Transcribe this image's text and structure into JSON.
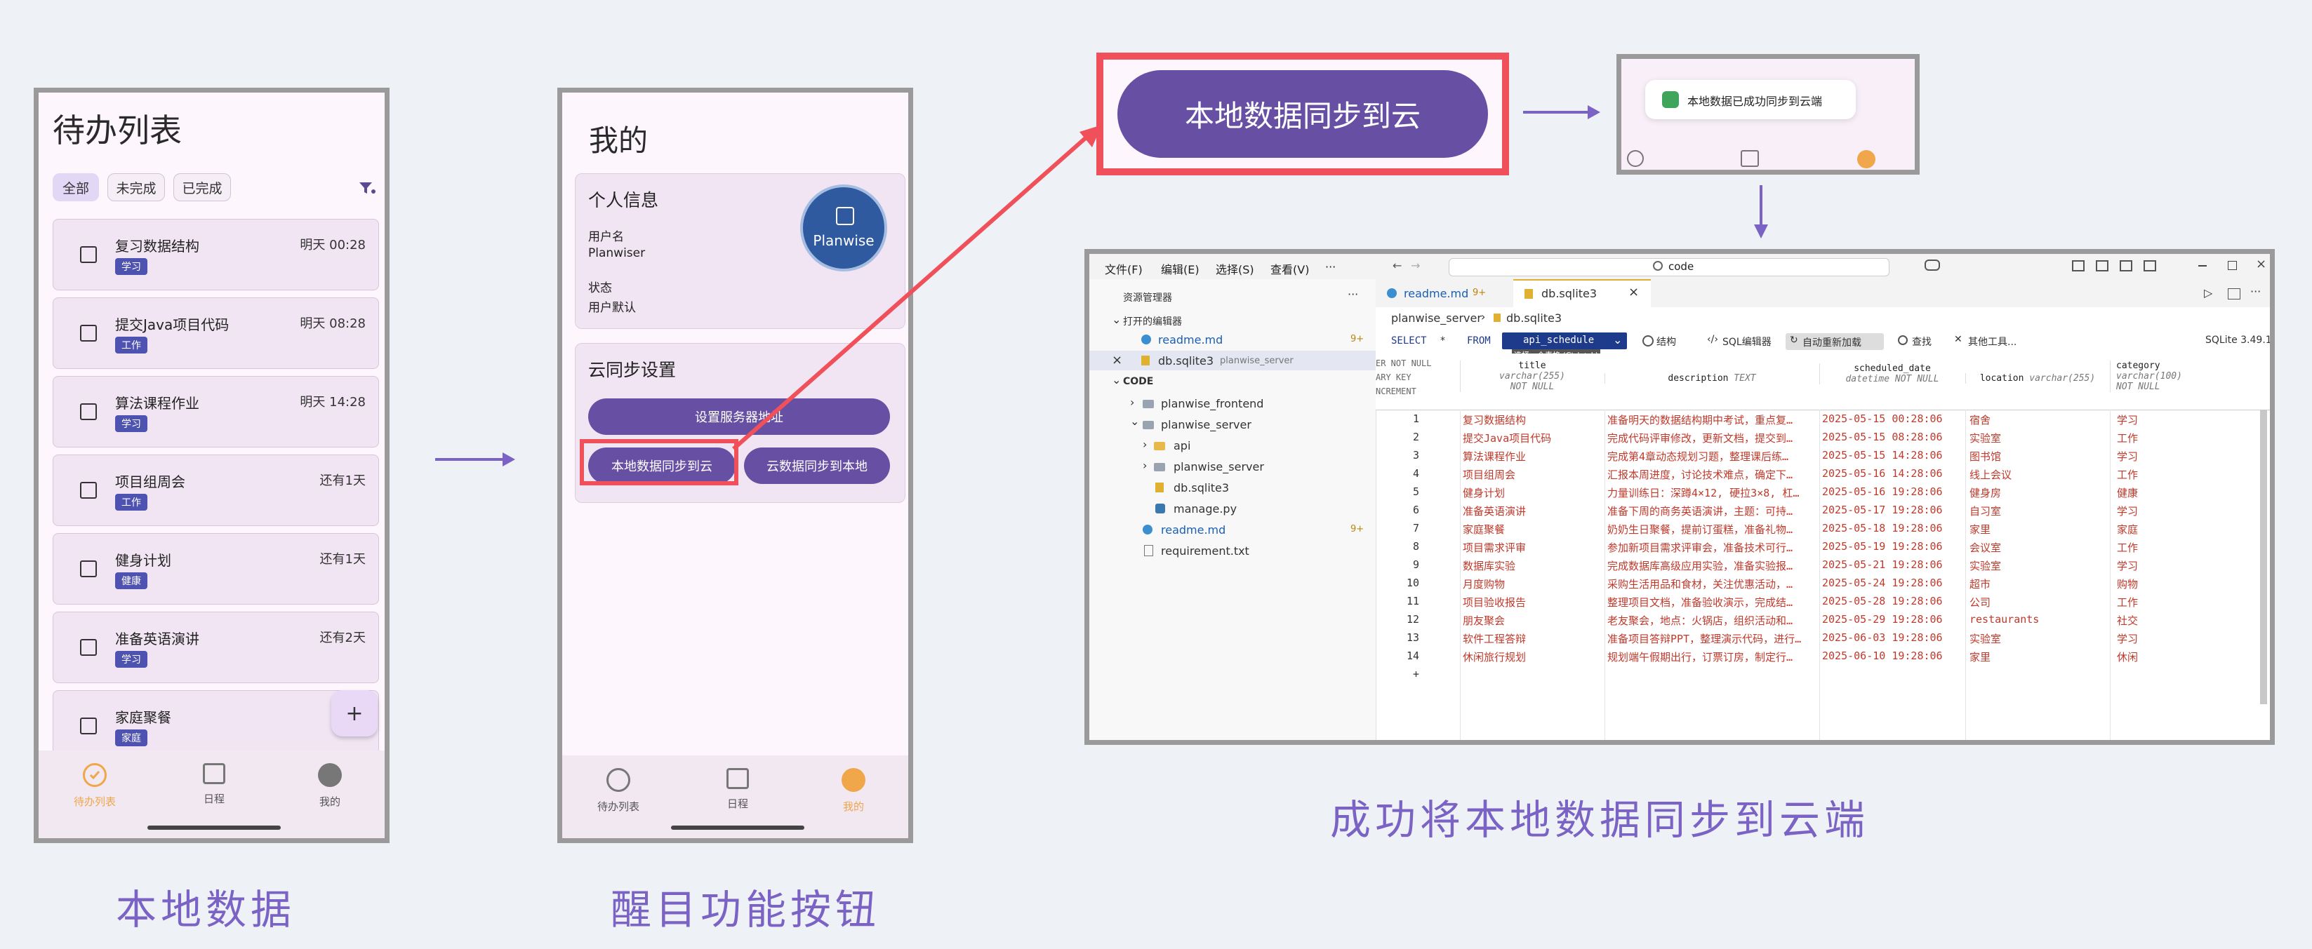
{
  "panel1": {
    "title": "待办列表",
    "filters": [
      "全部",
      "未完成",
      "已完成"
    ],
    "tasks": [
      {
        "title": "复习数据结构",
        "time": "明天 00:28",
        "tag": "学习"
      },
      {
        "title": "提交Java项目代码",
        "time": "明天 08:28",
        "tag": "工作"
      },
      {
        "title": "算法课程作业",
        "time": "明天 14:28",
        "tag": "学习"
      },
      {
        "title": "项目组周会",
        "time": "还有1天",
        "tag": "工作"
      },
      {
        "title": "健身计划",
        "time": "还有1天",
        "tag": "健康"
      },
      {
        "title": "准备英语演讲",
        "time": "还有2天",
        "tag": "学习"
      },
      {
        "title": "家庭聚餐",
        "time": "还",
        "tag": "家庭"
      }
    ],
    "fab": "+",
    "nav": [
      "待办列表",
      "日程",
      "我的"
    ]
  },
  "panel2": {
    "title": "我的",
    "profile_heading": "个人信息",
    "username_label": "用户名",
    "username_value": "Planwiser",
    "status_label": "状态",
    "status_value": "用户默认",
    "avatar_text": "Planwise",
    "sync_heading": "云同步设置",
    "server_button": "设置服务器地址",
    "local_to_cloud": "本地数据同步到云",
    "cloud_to_local": "云数据同步到本地",
    "nav": [
      "待办列表",
      "日程",
      "我的"
    ]
  },
  "zoom_button": "本地数据同步到云",
  "toast": "本地数据已成功同步到云端",
  "captions": {
    "left": "本地数据",
    "middle": "醒目功能按钮",
    "right": "成功将本地数据同步到云端"
  },
  "vscode": {
    "menu": [
      "文件(F)",
      "编辑(E)",
      "选择(S)",
      "查看(V)",
      "···"
    ],
    "search": "code",
    "explorer_title": "资源管理器",
    "open_editors": "打开的编辑器",
    "open_files": [
      {
        "name": "readme.md",
        "badge": "9+"
      },
      {
        "name": "db.sqlite3",
        "extra": "planwise_server"
      }
    ],
    "code_folder": "CODE",
    "tree": [
      "planwise_frontend",
      "planwise_server",
      "api",
      "planwise_server",
      "db.sqlite3",
      "manage.py",
      "readme.md",
      "requirement.txt"
    ],
    "tree_badge": "9+",
    "tabs": [
      {
        "name": "readme.md",
        "badge": "9+"
      },
      {
        "name": "db.sqlite3"
      }
    ],
    "breadcrumb": [
      "planwise_server",
      "db.sqlite3"
    ],
    "query": {
      "select": "SELECT",
      "star": "*",
      "from": "FROM",
      "table": "api_schedule",
      "hint": "选择一个表格 (Ctrl + L)",
      "structure": "结构",
      "sql_editor": "SQL编辑器",
      "auto_reload": "自动重新加载",
      "find": "查找",
      "tools": "其他工具...",
      "version": "SQLite 3.49.1"
    },
    "columns": [
      {
        "name": "ER NOT NULL\nARY KEY\nNCREMENT",
        "type": ""
      },
      {
        "name": "title",
        "type": "varchar(255)\nNOT NULL"
      },
      {
        "name": "description",
        "type": "TEXT"
      },
      {
        "name": "scheduled_date",
        "type": "datetime NOT NULL"
      },
      {
        "name": "location",
        "type": "varchar(255)"
      },
      {
        "name": "category",
        "type": "varchar(100)\nNOT NULL"
      }
    ],
    "rows": [
      [
        "1",
        "复习数据结构",
        "准备明天的数据结构期中考试，重点复…",
        "2025-05-15 00:28:06",
        "宿舍",
        "学习"
      ],
      [
        "2",
        "提交Java项目代码",
        "完成代码评审修改，更新文档，提交到…",
        "2025-05-15 08:28:06",
        "实验室",
        "工作"
      ],
      [
        "3",
        "算法课程作业",
        "完成第4章动态规划习题，整理课后练…",
        "2025-05-15 14:28:06",
        "图书馆",
        "学习"
      ],
      [
        "4",
        "项目组周会",
        "汇报本周进度，讨论技术难点，确定下…",
        "2025-05-16 14:28:06",
        "线上会议",
        "工作"
      ],
      [
        "5",
        "健身计划",
        "力量训练日：深蹲4×12, 硬拉3×8, 杠…",
        "2025-05-16 19:28:06",
        "健身房",
        "健康"
      ],
      [
        "6",
        "准备英语演讲",
        "准备下周的商务英语演讲，主题：可持…",
        "2025-05-17 19:28:06",
        "自习室",
        "学习"
      ],
      [
        "7",
        "家庭聚餐",
        "奶奶生日聚餐，提前订蛋糕，准备礼物…",
        "2025-05-18 19:28:06",
        "家里",
        "家庭"
      ],
      [
        "8",
        "项目需求评审",
        "参加新项目需求评审会，准备技术可行…",
        "2025-05-19 19:28:06",
        "会议室",
        "工作"
      ],
      [
        "9",
        "数据库实验",
        "完成数据库高级应用实验，准备实验报…",
        "2025-05-21 19:28:06",
        "实验室",
        "学习"
      ],
      [
        "10",
        "月度购物",
        "采购生活用品和食材，关注优惠活动，…",
        "2025-05-24 19:28:06",
        "超市",
        "购物"
      ],
      [
        "11",
        "项目验收报告",
        "整理项目文档，准备验收演示，完成结…",
        "2025-05-28 19:28:06",
        "公司",
        "工作"
      ],
      [
        "12",
        "朋友聚会",
        "老友聚会，地点：火锅店，组织活动和…",
        "2025-05-29 19:28:06",
        "restaurants",
        "社交"
      ],
      [
        "13",
        "软件工程答辩",
        "准备项目答辩PPT，整理演示代码，进行…",
        "2025-06-03 19:28:06",
        "实验室",
        "学习"
      ],
      [
        "14",
        "休闲旅行规划",
        "规划端午假期出行，订票订房，制定行…",
        "2025-06-10 19:28:06",
        "家里",
        "休闲"
      ]
    ],
    "add_row": "+"
  },
  "colors": {
    "accent": "#6750a4",
    "highlight": "#f0505a",
    "caption": "#7a63c4",
    "arrow": "#7a63c4",
    "tag": "#4e52b0",
    "nav_active": "#f0a64a"
  }
}
